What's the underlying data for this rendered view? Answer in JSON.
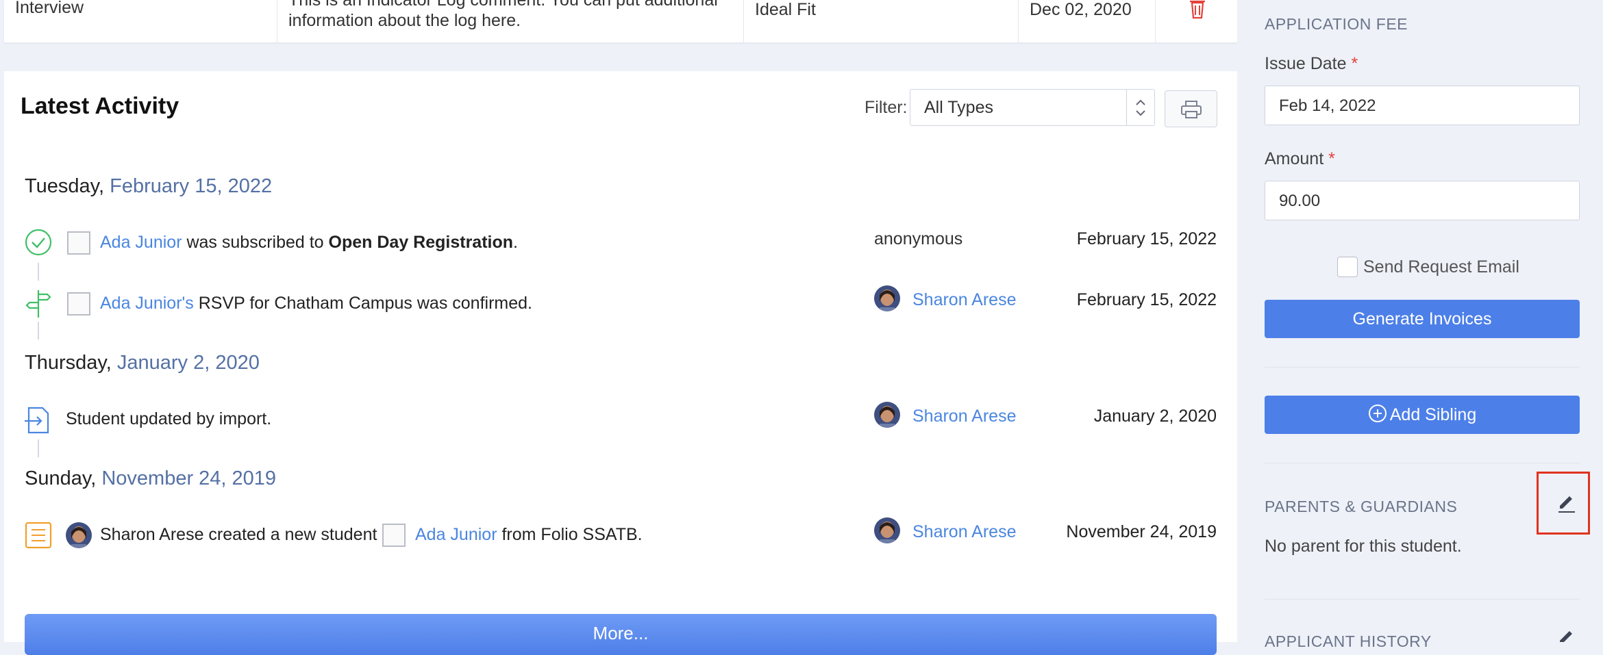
{
  "top_row": {
    "type": "Interview",
    "comment_line1": "This is an Indicator Log comment. You can put additional",
    "comment_line2": "information about the log here.",
    "category": "Ideal Fit",
    "date": "Dec 02, 2020",
    "delete_icon": "trash-icon"
  },
  "activity": {
    "title": "Latest Activity",
    "filter_label": "Filter:",
    "filter_value": "All Types",
    "print_icon": "printer-icon",
    "groups": [
      {
        "weekday": "Tuesday",
        "date": "February 15, 2022"
      },
      {
        "weekday": "Thursday",
        "date": "January 2, 2020"
      },
      {
        "weekday": "Sunday",
        "date": "November 24, 2019"
      }
    ],
    "items": [
      {
        "icon": "check-circle-icon",
        "name": "Ada Junior",
        "text": " was subscribed to ",
        "bold": "Open Day Registration",
        "end": ".",
        "who": "anonymous",
        "when": "February 15, 2022"
      },
      {
        "icon": "signpost-icon",
        "name": "Ada Junior's",
        "text": " RSVP for Chatham Campus was confirmed.",
        "who": "Sharon Arese",
        "when": "February 15, 2022"
      },
      {
        "icon": "import-icon",
        "text": "Student updated by import.",
        "who": "Sharon Arese",
        "when": "January 2, 2020"
      },
      {
        "icon": "document-list-icon",
        "text": "Sharon Arese created a new student ",
        "name": "Ada Junior",
        "end": " from Folio SSATB.",
        "who": "Sharon Arese",
        "when": "November 24, 2019"
      }
    ],
    "more_label": "More..."
  },
  "sidebar": {
    "fee_heading": "APPLICATION FEE",
    "issue_date_label": "Issue Date",
    "issue_date_value": "Feb 14, 2022",
    "amount_label": "Amount",
    "amount_value": "90.00",
    "required_mark": "*",
    "send_email_label": "Send Request Email",
    "generate_label": "Generate Invoices",
    "add_sibling_label": "Add Sibling",
    "parents_heading": "PARENTS & GUARDIANS",
    "no_parent_text": "No parent for this student.",
    "history_heading": "APPLICANT HISTORY"
  },
  "colors": {
    "accent": "#4c7fe8",
    "link": "#4a86e0",
    "highlight": "#e0321f"
  }
}
